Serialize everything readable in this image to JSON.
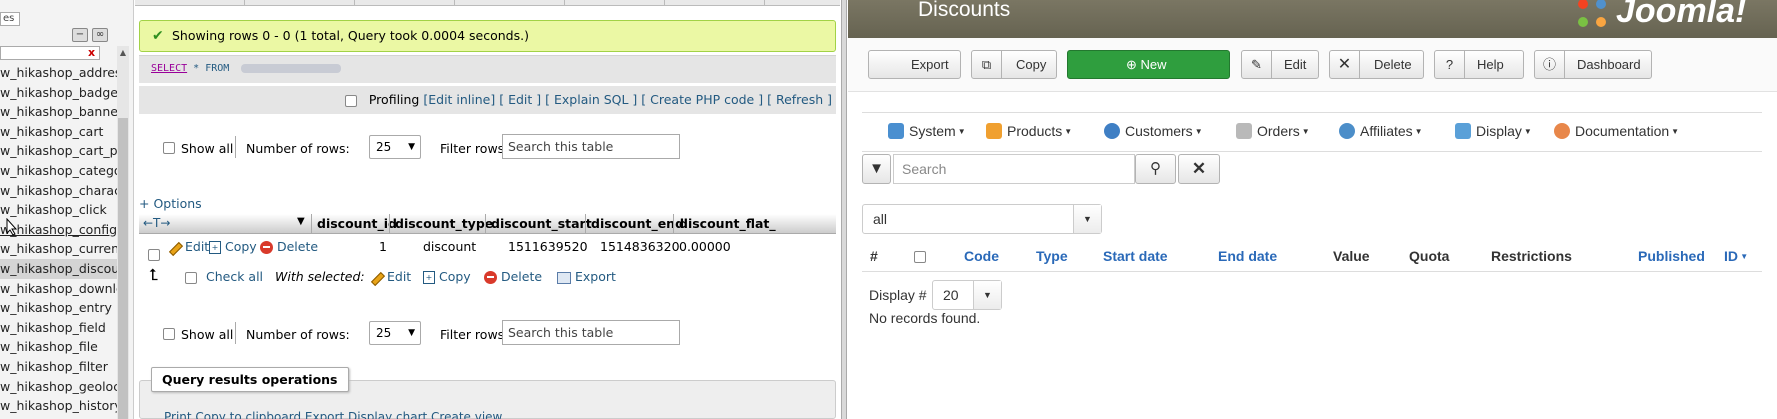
{
  "sidebar": {
    "top_label": "es",
    "items": [
      "w_hikashop_address",
      "w_hikashop_badge",
      "w_hikashop_banner",
      "w_hikashop_cart",
      "w_hikashop_cart_pr",
      "w_hikashop_categor",
      "w_hikashop_charact",
      "w_hikashop_click",
      "w_hikashop_config",
      "w_hikashop_currenc",
      "w_hikashop_discour",
      "w_hikashop_downlo",
      "w_hikashop_entry",
      "w_hikashop_field",
      "w_hikashop_file",
      "w_hikashop_filter",
      "w_hikashop_geoloca",
      "w_hikashop_history"
    ]
  },
  "pma": {
    "success_message": "Showing rows 0 - 0 (1 total, Query took 0.0004 seconds.)",
    "sql_select": "SELECT",
    "sql_star_from": "* FROM",
    "profiling": {
      "label": "Profiling",
      "edit_inline": "[Edit inline]",
      "edit": "[ Edit ]",
      "explain": "[ Explain SQL ]",
      "php_code": "[ Create PHP code ]",
      "refresh": "[ Refresh ]"
    },
    "nav": {
      "show_all": "Show all",
      "number_of_rows": "Number of rows:",
      "rows_value": "25",
      "filter_rows": "Filter rows:",
      "search_placeholder": "Search this table"
    },
    "options_link": "+ Options",
    "columns": [
      "discount_id",
      "discount_type",
      "discount_start",
      "discount_end",
      "discount_flat_"
    ],
    "row": {
      "edit": "Edit",
      "copy": "Copy",
      "delete": "Delete",
      "discount_id": "1",
      "discount_type": "discount",
      "discount_start": "1511639520",
      "discount_end": "1514836320",
      "discount_flat": "0.00000"
    },
    "with_selected": {
      "check_all": "Check all",
      "label": "With selected:",
      "edit": "Edit",
      "copy": "Copy",
      "delete": "Delete",
      "export": "Export"
    },
    "query_results_operations": "Query results operations",
    "qro_partial": "Print   Copy to clipboard   Export   Display chart   Create view"
  },
  "joomla": {
    "page_title": "Discounts",
    "logo_text": "Joomla!",
    "toolbar": {
      "export": "Export",
      "copy": "Copy",
      "new": "New",
      "edit": "Edit",
      "delete": "Delete",
      "help": "Help",
      "dashboard": "Dashboard"
    },
    "menu": [
      "System",
      "Products",
      "Customers",
      "Orders",
      "Affiliates",
      "Display",
      "Documentation"
    ],
    "search_placeholder": "Search",
    "filter_value": "all",
    "table_headers": {
      "num": "#",
      "code": "Code",
      "type": "Type",
      "start_date": "Start date",
      "end_date": "End date",
      "value": "Value",
      "quota": "Quota",
      "restrictions": "Restrictions",
      "published": "Published",
      "id": "ID"
    },
    "display_label": "Display #",
    "display_value": "20",
    "no_records": "No records found.",
    "colors": {
      "header_bg": "#6e6b5a",
      "new_button": "#2f9e3e",
      "link_blue": "#2a69b8"
    }
  }
}
